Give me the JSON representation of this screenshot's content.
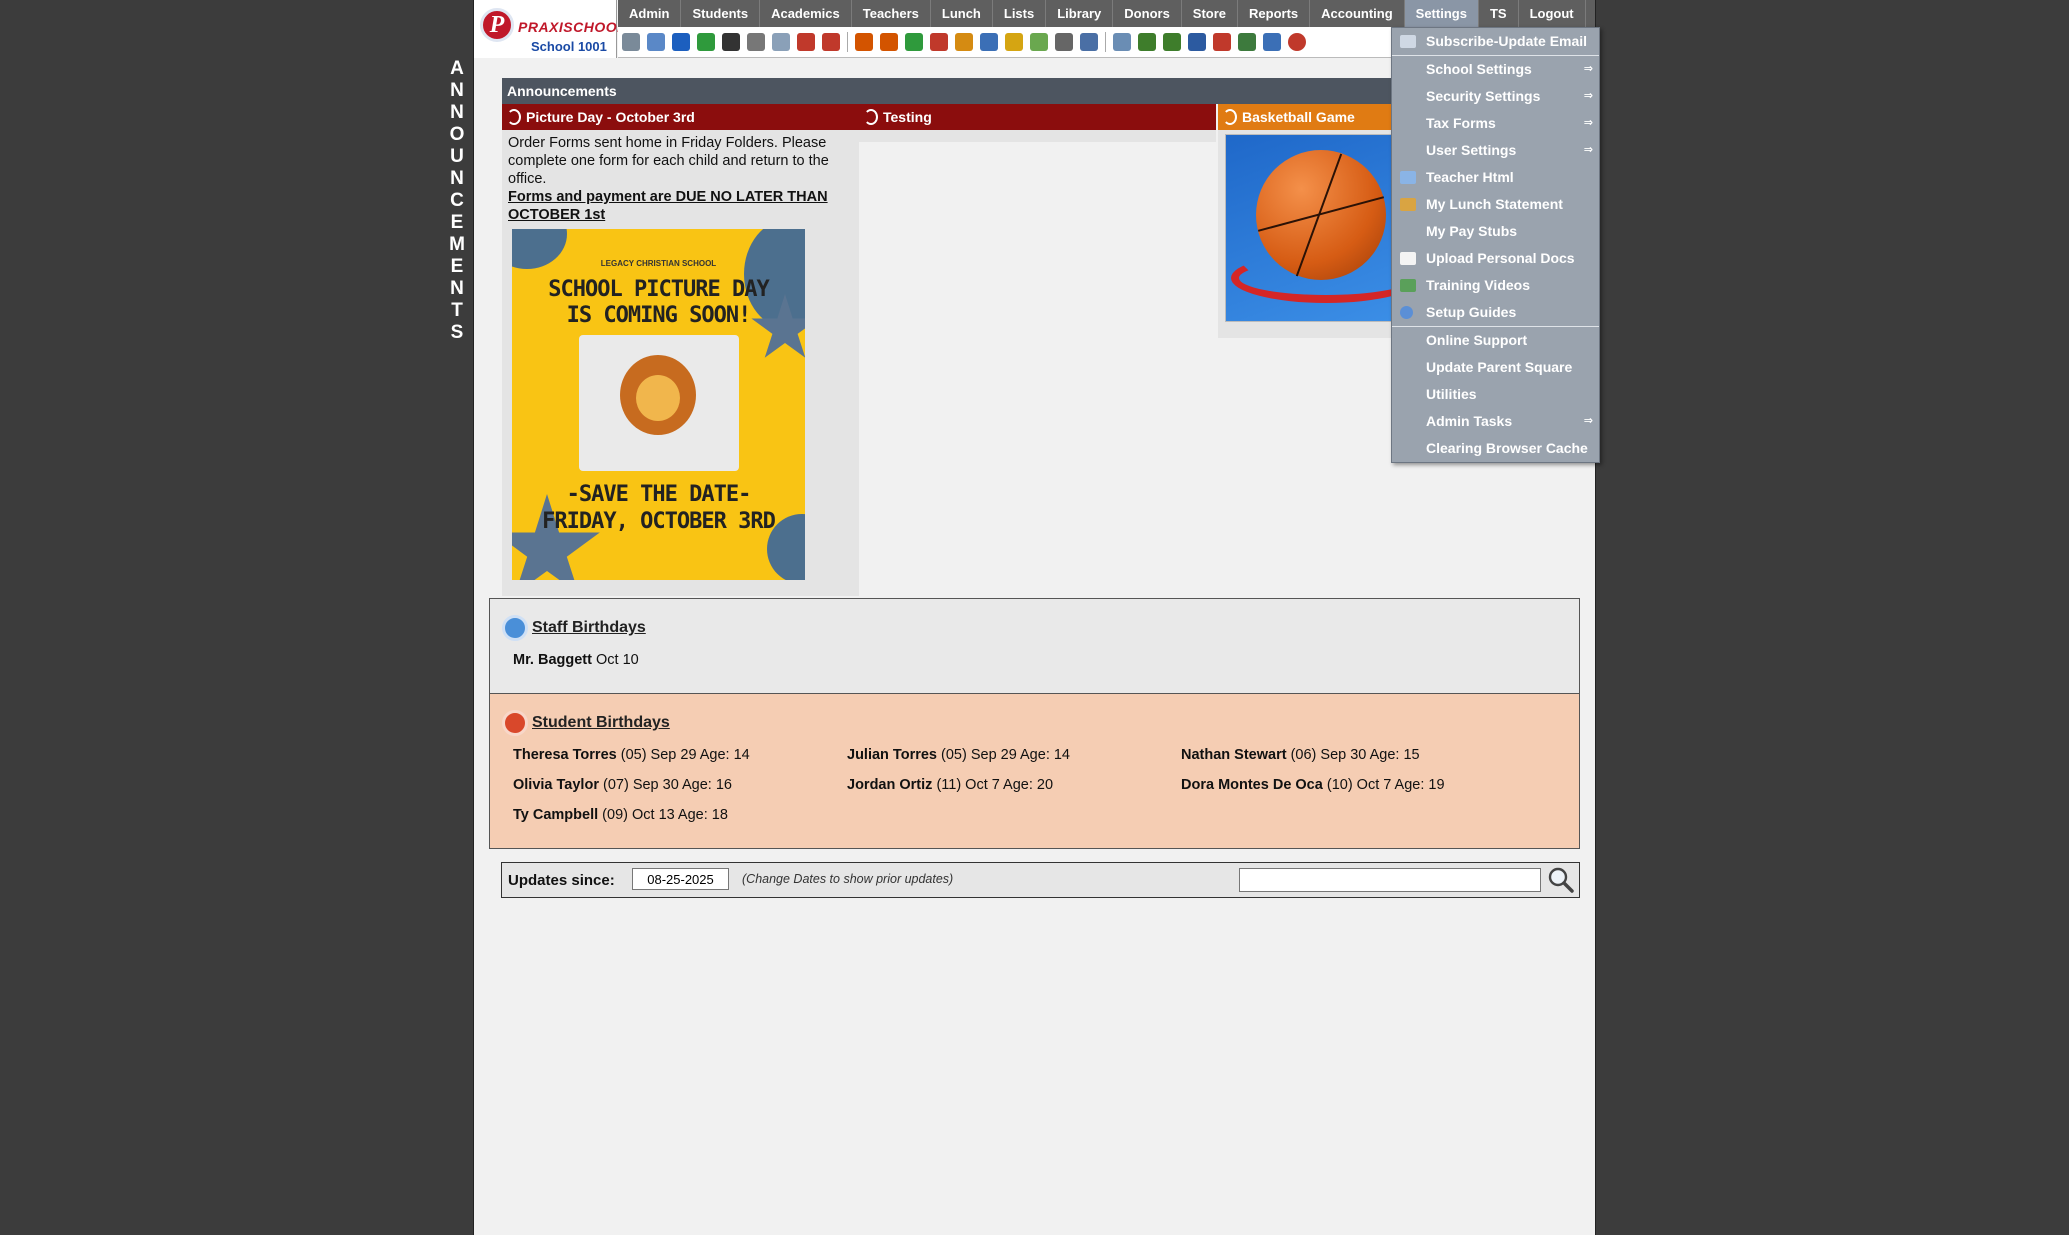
{
  "banner": {
    "letters": [
      "A",
      "N",
      "N",
      "O",
      "U",
      "N",
      "C",
      "E",
      "M",
      "E",
      "N",
      "T",
      "S"
    ]
  },
  "logo": {
    "mark": "P",
    "name": "PRAXISCHOOL",
    "school": "School 1001"
  },
  "menu": [
    "Admin",
    "Students",
    "Academics",
    "Teachers",
    "Lunch",
    "Lists",
    "Library",
    "Donors",
    "Store",
    "Reports",
    "Accounting",
    "Settings",
    "TS",
    "Logout"
  ],
  "toolbar_icons": [
    "search-icon",
    "grid-icon",
    "at-icon",
    "transfer-icon",
    "phone-icon",
    "speaker-icon",
    "calendar-grid-icon",
    "calendar-icon",
    "megaphone-icon",
    "person-icon",
    "person-icon",
    "pencil-icon",
    "people-icon",
    "lunch-icon",
    "book-icon",
    "edit-icon",
    "forward-icon",
    "user-icon",
    "clock-icon",
    "table-icon",
    "id-card-icon",
    "printer-icon",
    "ap-icon",
    "pdf-icon",
    "money-icon",
    "help-icon",
    "power-icon"
  ],
  "announcements": {
    "header": "Announcements",
    "items": [
      {
        "title": "Picture Day - October 3rd",
        "body": "Order Forms sent home in Friday Folders. Please complete one form for each child and return to the office.",
        "emphasis": "Forms and payment are DUE NO LATER THAN OCTOBER 1st",
        "poster": {
          "school": "LEGACY CHRISTIAN SCHOOL",
          "headline": "SCHOOL PICTURE DAY IS COMING SOON!",
          "save": "-SAVE THE DATE-",
          "date": "FRIDAY, OCTOBER 3RD"
        }
      },
      {
        "title": "Testing"
      },
      {
        "title": "Basketball Game"
      }
    ]
  },
  "settings_menu": {
    "items": [
      {
        "label": "Subscribe-Update Email",
        "icon": "envelope-icon",
        "submenu": false
      },
      {
        "label": "School Settings",
        "icon": "",
        "submenu": true
      },
      {
        "label": "Security Settings",
        "icon": "",
        "submenu": true
      },
      {
        "label": "Tax Forms",
        "icon": "",
        "submenu": true
      },
      {
        "label": "User Settings",
        "icon": "",
        "submenu": true
      },
      {
        "label": "Teacher Html",
        "icon": "html-icon",
        "submenu": false
      },
      {
        "label": "My Lunch Statement",
        "icon": "burger-icon",
        "submenu": false
      },
      {
        "label": "My Pay Stubs",
        "icon": "",
        "submenu": false
      },
      {
        "label": "Upload Personal Docs",
        "icon": "document-icon",
        "submenu": false
      },
      {
        "label": "Training Videos",
        "icon": "film-icon",
        "submenu": false
      },
      {
        "label": "Setup Guides",
        "icon": "help-icon",
        "submenu": false
      },
      {
        "label": "Online Support",
        "icon": "",
        "submenu": false,
        "divider_before": true
      },
      {
        "label": "Update Parent Square",
        "icon": "",
        "submenu": false
      },
      {
        "label": "Utilities",
        "icon": "",
        "submenu": false
      },
      {
        "label": "Admin Tasks",
        "icon": "",
        "submenu": true
      },
      {
        "label": "Clearing Browser Cache",
        "icon": "",
        "submenu": false
      }
    ],
    "submenu_arrow": "⇒"
  },
  "staff_birthdays": {
    "title": "Staff Birthdays",
    "entries": [
      {
        "name": "Mr. Baggett",
        "info": "Oct 10"
      }
    ]
  },
  "student_birthdays": {
    "title": "Student Birthdays",
    "entries": [
      {
        "name": "Theresa Torres",
        "info": "(05) Sep 29 Age: 14"
      },
      {
        "name": "Julian Torres",
        "info": "(05) Sep 29 Age: 14"
      },
      {
        "name": "Nathan Stewart",
        "info": "(06) Sep 30 Age: 15"
      },
      {
        "name": "Olivia Taylor",
        "info": "(07) Sep 30 Age: 16"
      },
      {
        "name": "Jordan Ortiz",
        "info": "(11) Oct 7 Age: 20"
      },
      {
        "name": "Dora Montes De Oca",
        "info": "(10) Oct 7 Age: 19"
      },
      {
        "name": "Ty Campbell",
        "info": "(09) Oct 13 Age: 18"
      }
    ]
  },
  "updates": {
    "label": "Updates since:",
    "date": "08-25-2025",
    "note": "(Change Dates to show prior updates)",
    "search_value": ""
  },
  "colors": {
    "menubar": "#5f5f5f",
    "settings_menu": "#9aa3ae",
    "ann_title_red": "#8b0d0d",
    "ann_title_orange": "#e07b13",
    "student_bg": "#f5cdb3",
    "staff_bg": "#e9e9e9"
  }
}
